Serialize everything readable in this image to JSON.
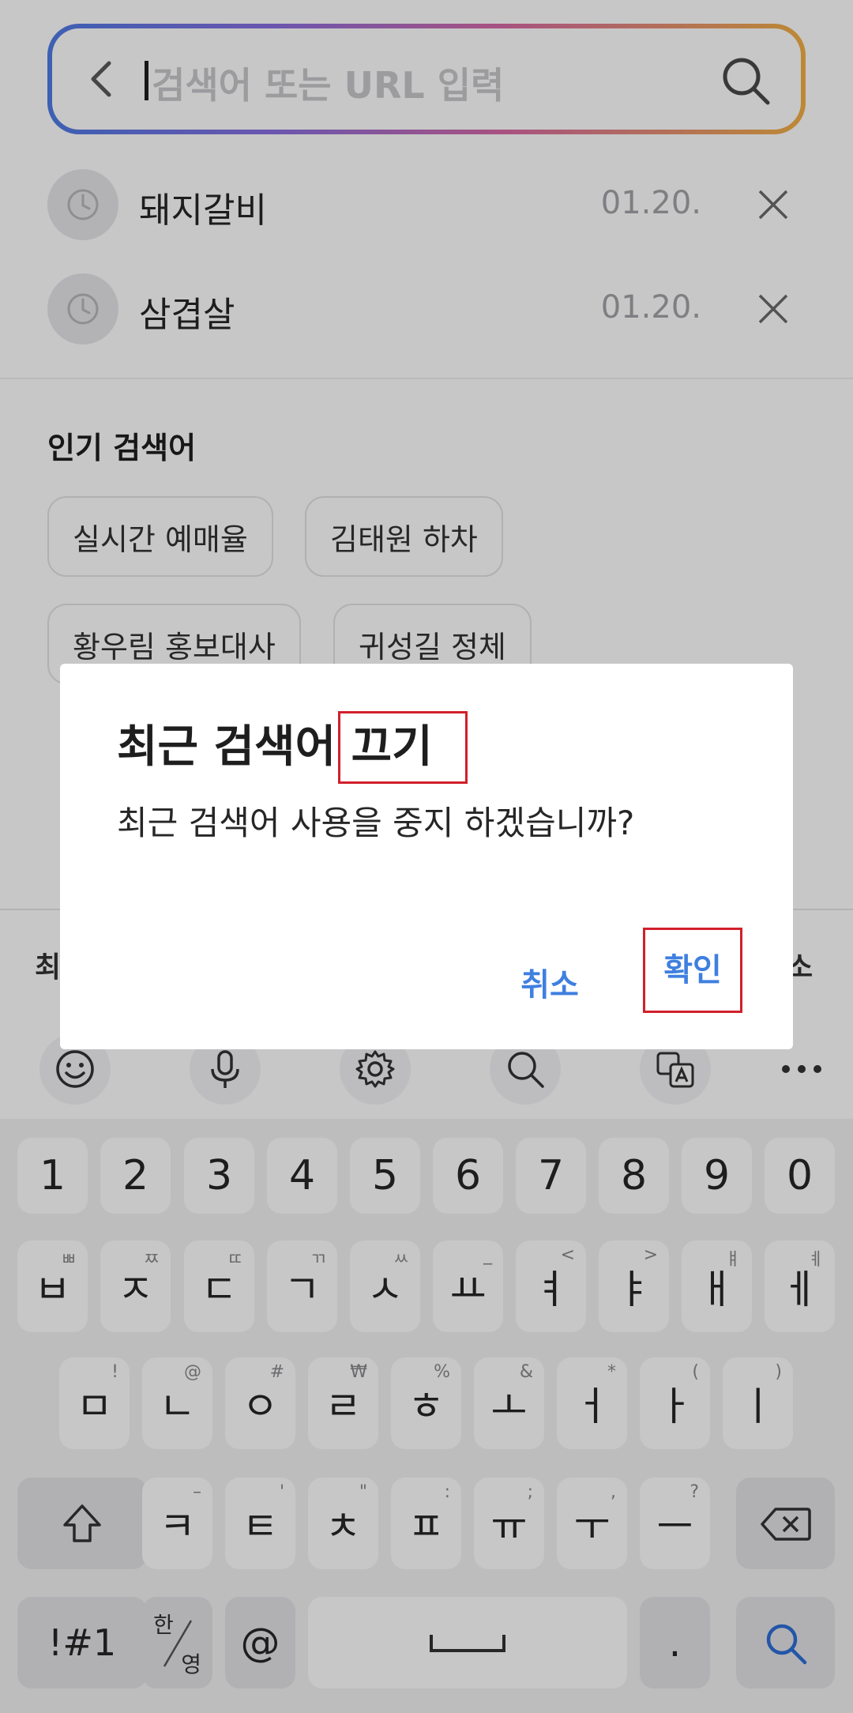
{
  "search": {
    "placeholder": "검색어 또는 URL 입력"
  },
  "recent": [
    {
      "text": "돼지갈비",
      "date": "01.20."
    },
    {
      "text": "삼겹살",
      "date": "01.20."
    }
  ],
  "popular": {
    "title": "인기 검색어",
    "chips": [
      "실시간 예매율",
      "김태원 하차",
      "황우림 홍보대사",
      "귀성길 정체"
    ]
  },
  "under_dialog": {
    "left_fragment": "최",
    "right_fragment": "소"
  },
  "dialog": {
    "title": "최근 검색어 끄기",
    "message": "최근 검색어 사용을 중지 하겠습니까?",
    "cancel": "취소",
    "confirm": "확인"
  },
  "keyboard": {
    "numbers": [
      "1",
      "2",
      "3",
      "4",
      "5",
      "6",
      "7",
      "8",
      "9",
      "0"
    ],
    "row1": [
      {
        "main": "ㅂ",
        "sub": "ㅃ"
      },
      {
        "main": "ㅈ",
        "sub": "ㅉ"
      },
      {
        "main": "ㄷ",
        "sub": "ㄸ"
      },
      {
        "main": "ㄱ",
        "sub": "ㄲ"
      },
      {
        "main": "ㅅ",
        "sub": "ㅆ"
      },
      {
        "main": "ㅛ",
        "sub": "_"
      },
      {
        "main": "ㅕ",
        "sub": "<"
      },
      {
        "main": "ㅑ",
        "sub": ">"
      },
      {
        "main": "ㅐ",
        "sub": "ㅒ"
      },
      {
        "main": "ㅔ",
        "sub": "ㅖ"
      }
    ],
    "row2": [
      {
        "main": "ㅁ",
        "sub": "!"
      },
      {
        "main": "ㄴ",
        "sub": "@"
      },
      {
        "main": "ㅇ",
        "sub": "#"
      },
      {
        "main": "ㄹ",
        "sub": "₩"
      },
      {
        "main": "ㅎ",
        "sub": "%"
      },
      {
        "main": "ㅗ",
        "sub": "&"
      },
      {
        "main": "ㅓ",
        "sub": "*"
      },
      {
        "main": "ㅏ",
        "sub": "("
      },
      {
        "main": "ㅣ",
        "sub": ")"
      }
    ],
    "row3": [
      {
        "main": "ㅋ",
        "sub": "–"
      },
      {
        "main": "ㅌ",
        "sub": "'"
      },
      {
        "main": "ㅊ",
        "sub": "\""
      },
      {
        "main": "ㅍ",
        "sub": ":"
      },
      {
        "main": "ㅠ",
        "sub": ";"
      },
      {
        "main": "ㅜ",
        "sub": ","
      },
      {
        "main": "ㅡ",
        "sub": "?"
      }
    ],
    "symbols": "!#1",
    "lang_han": "한",
    "lang_eng": "영",
    "at": "@",
    "period": "."
  },
  "colors": {
    "accent": "#3f7fe0",
    "highlight_box": "#d21f2b"
  }
}
